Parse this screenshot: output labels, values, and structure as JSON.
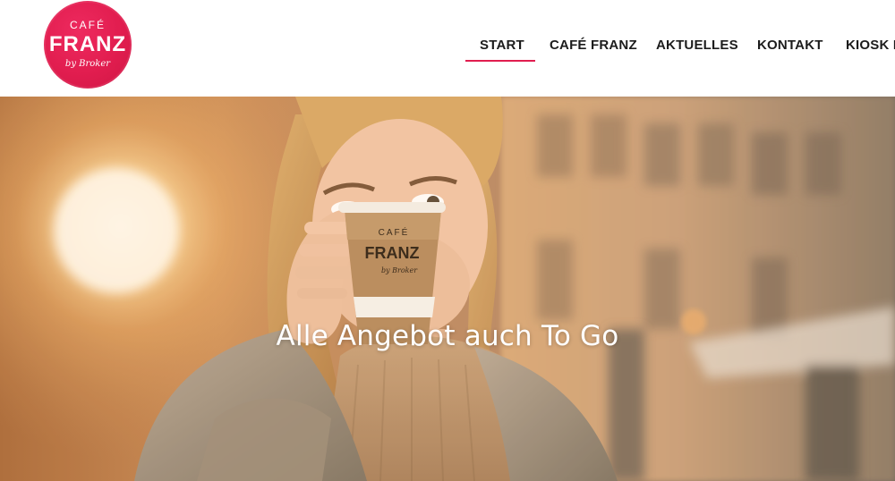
{
  "logo": {
    "top": "CAFÉ",
    "main": "FRANZ",
    "sub": "by Broker"
  },
  "nav": {
    "items": [
      {
        "label": "START",
        "active": true
      },
      {
        "label": "CAFÉ FRANZ"
      },
      {
        "label": "AKTUELLES"
      },
      {
        "label": "KONTAKT"
      },
      {
        "label": "KIOSK FI"
      }
    ]
  },
  "hero": {
    "caption": "Alle Angebot auch To Go",
    "cup": {
      "top": "CAFÉ",
      "main": "FRANZ",
      "sub": "by Broker"
    }
  },
  "colors": {
    "accent": "#e11d4f",
    "nav_text": "#1c1c1c",
    "hero_caption": "#ffffff"
  }
}
